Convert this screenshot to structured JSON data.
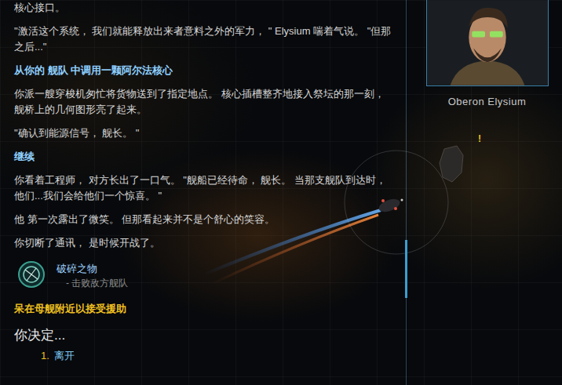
{
  "log": [
    {
      "kind": "text",
      "text": "核心接口。"
    },
    {
      "kind": "text",
      "text": "\"激活这个系统， 我们就能释放出来者意料之外的军力， \" Elysium 喘着气说。 \"但那之后...\""
    },
    {
      "kind": "choice",
      "text": "从你的 舰队 中调用一颗阿尔法核心"
    },
    {
      "kind": "text",
      "text": "你派一艘穿梭机匆忙将货物送到了指定地点。 核心插槽整齐地接入祭坛的那一刻， 舰桥上的几何图形亮了起来。"
    },
    {
      "kind": "text",
      "text": "\"确认到能源信号， 舰长。 \""
    },
    {
      "kind": "choice",
      "text": "继续"
    },
    {
      "kind": "text",
      "text": "你看着工程师， 对方长出了一口气。 \"舰船已经待命， 舰长。 当那支舰队到达时， 他们...我们会给他们一个惊喜。 \""
    },
    {
      "kind": "text",
      "text": "他 第一次露出了微笑。 但那看起来并不是个舒心的笑容。"
    },
    {
      "kind": "text",
      "text": "你切断了通讯， 是时候开战了。"
    }
  ],
  "mission": {
    "title": "破碎之物",
    "subtitle": "- 击败敌方舰队"
  },
  "hint": "呆在母舰附近以接受援助",
  "prompt": "你决定...",
  "options": [
    {
      "number": "1.",
      "label": "离开",
      "selected": false
    }
  ],
  "portrait": {
    "name": "Oberon Elysium"
  },
  "alert": "!"
}
